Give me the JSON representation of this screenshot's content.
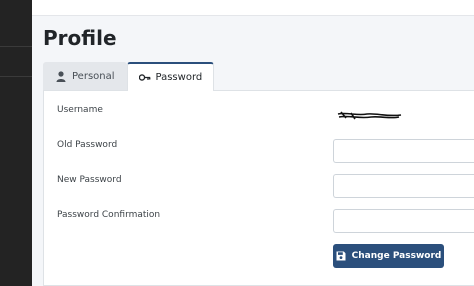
{
  "page": {
    "title": "Profile"
  },
  "tabs": [
    {
      "label": "Personal",
      "icon": "user-icon",
      "active": false
    },
    {
      "label": "Password",
      "icon": "key-icon",
      "active": true
    }
  ],
  "form": {
    "username_label": "Username",
    "old_password_label": "Old Password",
    "new_password_label": "New Password",
    "confirm_label": "Password Confirmation",
    "old_password_value": "",
    "new_password_value": "",
    "confirm_value": "",
    "submit_label": "Change Password",
    "submit_icon": "save-icon"
  },
  "colors": {
    "primary": "#2b4f7c",
    "sidebar": "#232323"
  }
}
